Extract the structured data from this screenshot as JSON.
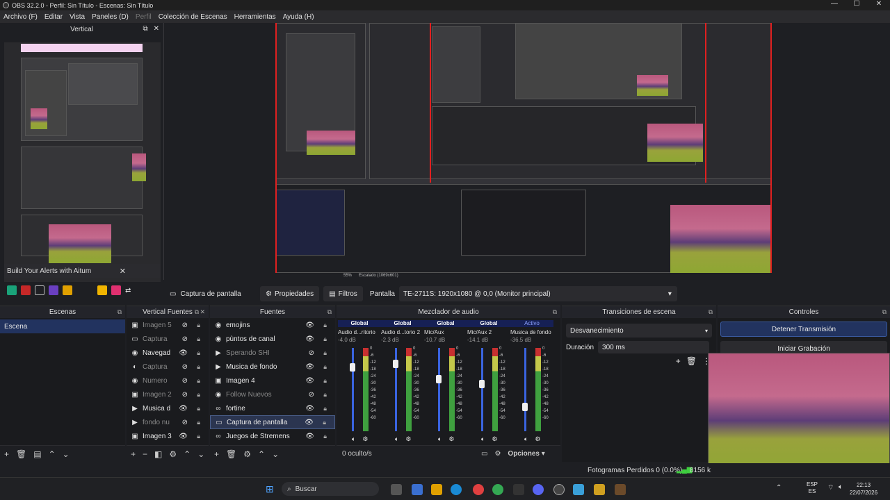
{
  "window": {
    "title": "OBS 32.2.0 - Perfil: Sin Título - Escenas: Sin Título",
    "min": "—",
    "max": "☐",
    "close": "✕"
  },
  "menu": [
    "Archivo (F)",
    "Editar",
    "Vista",
    "Paneles (D)",
    "Perfil",
    "Colección de Escenas",
    "Herramientas",
    "Ayuda (H)"
  ],
  "vertical": {
    "title": "Vertical",
    "alerts_title": "Build Your Alerts with Aitum"
  },
  "preview": {
    "zoom": "55%",
    "scale_info": "Escalado (1069x601)"
  },
  "context": {
    "source_name": "Captura de pantalla",
    "properties": "Propiedades",
    "filters": "Filtros",
    "display_label": "Pantalla",
    "display_value": "TE-2711S: 1920x1080 @ 0,0 (Monitor principal)"
  },
  "scenes": {
    "title": "Escenas",
    "items": [
      "Escena"
    ]
  },
  "vsources": {
    "title": "Vertical Fuentes",
    "items": [
      "Imagen 5",
      "Captura",
      "Navegad",
      "Captura",
      "Numero",
      "Imagen 2",
      "Musica d",
      "fondo nu",
      "Imagen 3"
    ]
  },
  "sources": {
    "title": "Fuentes",
    "items": [
      "emojins",
      "pùntos de canal",
      "Sperando SHI",
      "Musica de fondo",
      "Imagen 4",
      "Follow Nuevos",
      "fortine",
      "Captura de pantalla",
      "Juegos de Stremens"
    ]
  },
  "mixer": {
    "title": "Mezclador de audio",
    "hidden": "0 oculto/s",
    "options": "Opciones",
    "channels": [
      {
        "tab": "Global",
        "name": "Audio d...ritorio",
        "db": "-4.0 dB",
        "level": 0.8
      },
      {
        "tab": "Global",
        "name": "Audio d...torio 2",
        "db": "-2.3 dB",
        "level": 0.85
      },
      {
        "tab": "Global",
        "name": "Mic/Aux",
        "db": "-10.7 dB",
        "level": 0.65
      },
      {
        "tab": "Global",
        "name": "Mic/Aux 2",
        "db": "-14.1 dB",
        "level": 0.58
      },
      {
        "tab": "Activo",
        "name": "Musica de fondo",
        "db": "-36.5 dB",
        "level": 0.28
      }
    ],
    "scale": [
      "0",
      "-6",
      "-12",
      "-18",
      "-24",
      "-30",
      "-36",
      "-42",
      "-48",
      "-54",
      "-60"
    ]
  },
  "transitions": {
    "title": "Transiciones de escena",
    "selected": "Desvanecimiento",
    "duration_label": "Duración",
    "duration_value": "300 ms"
  },
  "controls": {
    "title": "Controles",
    "stop_stream": "Detener Transmisión",
    "start_record": "Iniciar Grabación"
  },
  "status": {
    "dropped": "Fotogramas Perdidos 0 (0.0%)",
    "bitrate": "8156 k"
  },
  "taskbar": {
    "search": "Buscar",
    "lang1": "ESP",
    "lang2": "ES",
    "time": "22:13",
    "date": "22/07/2026"
  },
  "colors": {
    "accent": "#162055",
    "selected": "#2b3550",
    "stream_btn": "#22335f",
    "record": "#c62828"
  }
}
